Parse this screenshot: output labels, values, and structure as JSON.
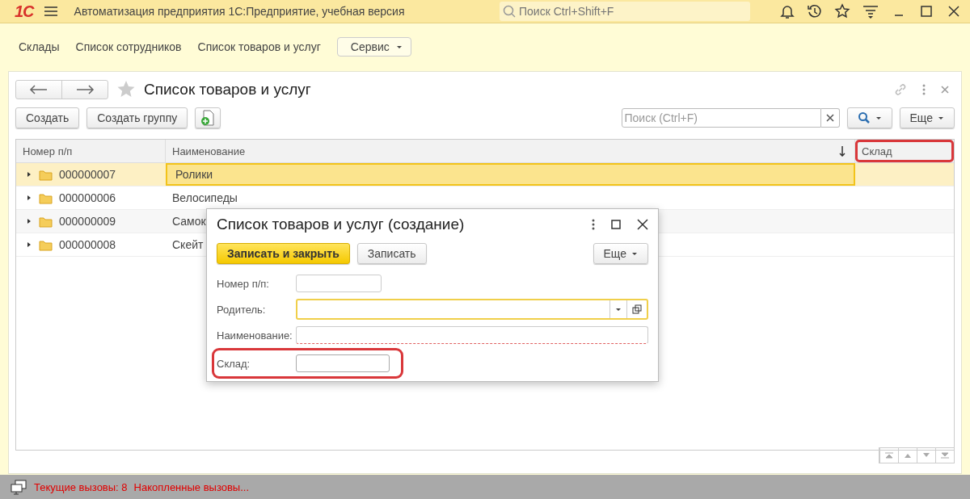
{
  "app_bar": {
    "logo": "1С",
    "title": "Автоматизация предприятия 1С:Предприятие, учебная версия",
    "search": {
      "placeholder": "Поиск Ctrl+Shift+F"
    }
  },
  "sections": [
    {
      "label": "Склады",
      "kind": "link"
    },
    {
      "label": "Список сотрудников",
      "kind": "link"
    },
    {
      "label": "Список товаров и услуг",
      "kind": "link"
    },
    {
      "label": "Сервис",
      "kind": "dropdown"
    }
  ],
  "form": {
    "title": "Список товаров и услуг",
    "toolbar": {
      "buttons": [
        "Создать",
        "Создать группу"
      ],
      "search": {
        "placeholder": "Поиск (Ctrl+F)"
      },
      "more": "Еще"
    },
    "table": {
      "columns": [
        {
          "label": "Номер п/п",
          "sort": false,
          "highlighted": false
        },
        {
          "label": "Наименование",
          "sort": true,
          "highlighted": false
        },
        {
          "label": "Склад",
          "sort": false,
          "highlighted": true
        }
      ],
      "rows": [
        {
          "number": "000000007",
          "name": "Ролики",
          "selected": true
        },
        {
          "number": "000000006",
          "name": "Велосипеды",
          "selected": false
        },
        {
          "number": "000000009",
          "name": "Самок",
          "selected": false
        },
        {
          "number": "000000008",
          "name": "Скейт",
          "selected": false
        }
      ]
    }
  },
  "dialog": {
    "title": "Список товаров и услуг (создание)",
    "primary": "Записать и закрыть",
    "secondary": "Записать",
    "more": "Еще",
    "fields": [
      {
        "label": "Номер п/п:",
        "kind": "short",
        "focused": false,
        "required": false,
        "highlighted": false
      },
      {
        "label": "Родитель:",
        "kind": "select",
        "focused": true,
        "required": false,
        "highlighted": false
      },
      {
        "label": "Наименование:",
        "kind": "text",
        "focused": false,
        "required": true,
        "highlighted": false
      },
      {
        "label": "Склад:",
        "kind": "short",
        "focused": false,
        "required": false,
        "highlighted": true
      }
    ]
  },
  "status_bar": {
    "items": [
      "Текущие вызовы: 8",
      "Накопленные вызовы..."
    ]
  }
}
